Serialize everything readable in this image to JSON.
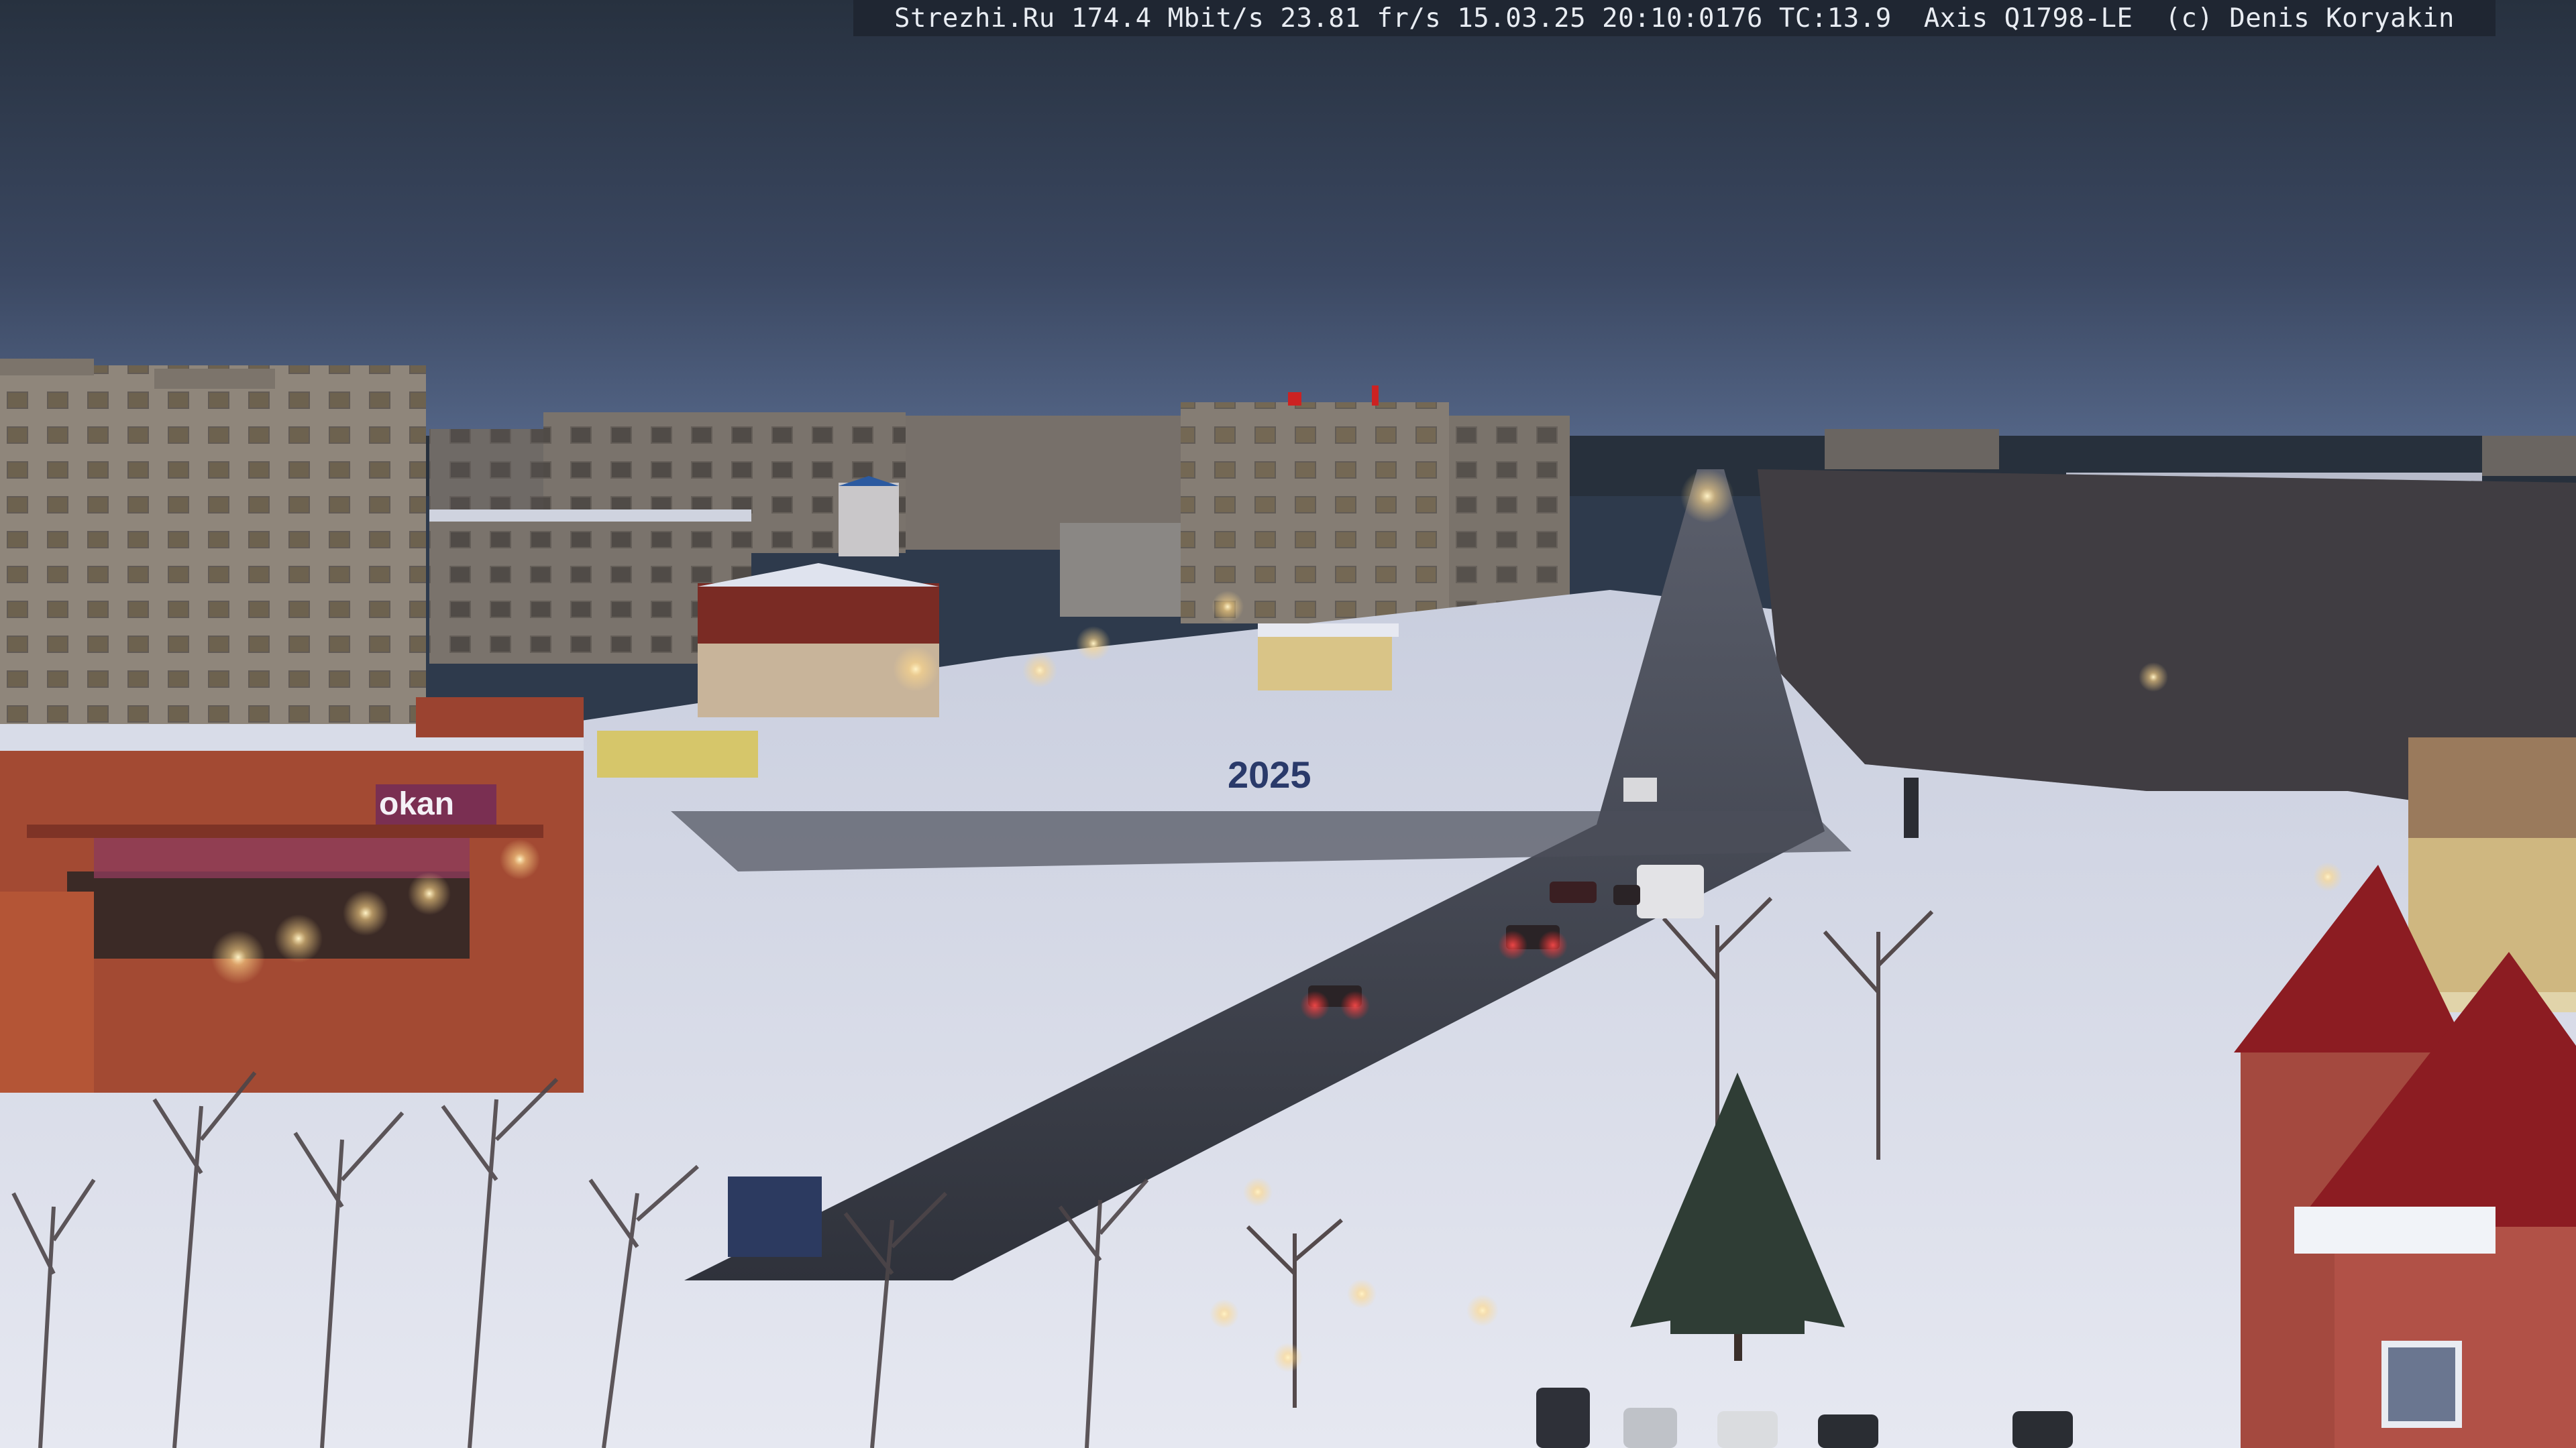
{
  "camera_overlay": {
    "text": "Strezhi.Ru 174.4 Mbit/s 23.81 fr/s 15.03.25 20:10:0176 TC:13.9  Axis Q1798-LE  (c) Denis Koryakin"
  },
  "signs": {
    "year_sculpture": "2025",
    "shop_logo": "okan"
  },
  "colors": {
    "sky_top": "#2b3547",
    "sky_bottom": "#4a5a78",
    "snow": "#dfe3ee",
    "road": "#3a3d46",
    "building": "#8c8378",
    "brick": "#a0452e",
    "roof_red": "#8c1c22"
  }
}
